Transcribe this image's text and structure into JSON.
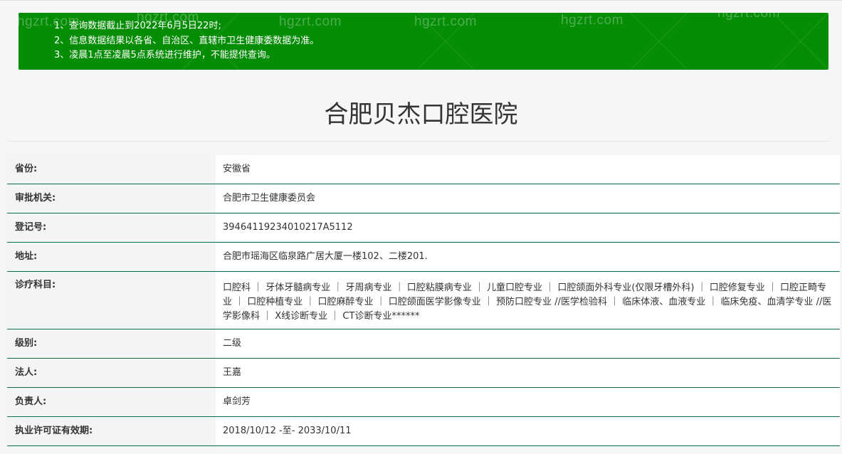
{
  "notice": {
    "lines": [
      "1、查询数据截止到2022年6月5日22时;",
      "2、信息数据结果以各省、自治区、直辖市卫生健康委数据为准。",
      "3、凌晨1点至凌晨5点系统进行维护，不能提供查询。"
    ],
    "watermark": "hgzrt.com",
    "background_color": "#068d06"
  },
  "page_title": "合肥贝杰口腔医院",
  "fields": [
    {
      "label": "省份:",
      "value": "安徽省"
    },
    {
      "label": "审批机关:",
      "value": "合肥市卫生健康委员会"
    },
    {
      "label": "登记号:",
      "value": "39464119234010217A5112"
    },
    {
      "label": "地址:",
      "value": "合肥市瑶海区临泉路广居大厦一楼102、二楼201."
    },
    {
      "label": "诊疗科目:",
      "value": "口腔科 ｜ 牙体牙髓病专业 ｜ 牙周病专业 ｜ 口腔粘膜病专业 ｜ 儿童口腔专业 ｜ 口腔颌面外科专业(仅限牙槽外科) ｜ 口腔修复专业 ｜ 口腔正畸专业 ｜ 口腔种植专业 ｜ 口腔麻醉专业 ｜ 口腔颌面医学影像专业 ｜ 预防口腔专业 //医学检验科 ｜ 临床体液、血液专业 ｜ 临床免疫、血清学专业 //医学影像科 ｜ X线诊断专业 ｜ CT诊断专业******"
    },
    {
      "label": "级别:",
      "value": "二级"
    },
    {
      "label": "法人:",
      "value": "王嘉"
    },
    {
      "label": "负责人:",
      "value": "卓剑芳"
    },
    {
      "label": "执业许可证有效期:",
      "value": "2018/10/12 -至- 2033/10/11"
    }
  ],
  "colors": {
    "row_divider": "#0d6e3f",
    "label_background": "#f4f4f4",
    "value_background": "#ffffff"
  }
}
